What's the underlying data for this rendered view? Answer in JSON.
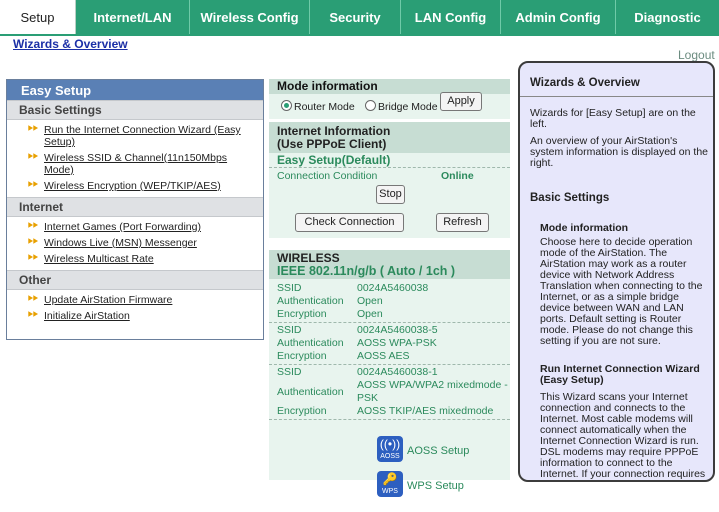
{
  "tabs": [
    {
      "label": "Setup",
      "active": true
    },
    {
      "label": "Internet/LAN",
      "active": false
    },
    {
      "label": "Wireless Config",
      "active": false
    },
    {
      "label": "Security",
      "active": false
    },
    {
      "label": "LAN Config",
      "active": false
    },
    {
      "label": "Admin Config",
      "active": false
    },
    {
      "label": "Diagnostic",
      "active": false
    }
  ],
  "breadcrumb": "Wizards & Overview",
  "logout": "Logout",
  "easy_setup": {
    "title": "Easy Setup",
    "sections": [
      {
        "title": "Basic Settings",
        "items": [
          "Run the Internet Connection Wizard (Easy Setup)",
          "Wireless SSID & Channel(11n150Mbps Mode)",
          "Wireless Encryption (WEP/TKIP/AES)"
        ]
      },
      {
        "title": "Internet",
        "items": [
          "Internet Games (Port Forwarding)",
          "Windows Live (MSN) Messenger",
          "Wireless Multicast Rate"
        ]
      },
      {
        "title": "Other",
        "items": [
          "Update AirStation Firmware",
          "Initialize AirStation"
        ]
      }
    ]
  },
  "mode": {
    "title": "Mode information",
    "router_label": "Router Mode",
    "bridge_label": "Bridge Mode",
    "selected": "router",
    "apply_label": "Apply"
  },
  "internet": {
    "title_line1": "Internet Information",
    "title_line2": "(Use PPPoE Client)",
    "subtitle": "Easy Setup(Default)",
    "condition_label": "Connection Condition",
    "condition_value": "Online",
    "stop_label": "Stop",
    "check_label": "Check Connection",
    "refresh_label": "Refresh"
  },
  "wireless": {
    "title": "WIRELESS",
    "standard": "IEEE 802.11n/g/b ( Auto / 1ch )",
    "entries": [
      {
        "ssid_label": "SSID",
        "ssid": "0024A5460038",
        "auth_label": "Authentication",
        "auth": "Open",
        "enc_label": "Encryption",
        "enc": "Open"
      },
      {
        "ssid_label": "SSID",
        "ssid": "0024A5460038-5",
        "auth_label": "Authentication",
        "auth": "AOSS WPA-PSK",
        "enc_label": "Encryption",
        "enc": "AOSS AES"
      },
      {
        "ssid_label": "SSID",
        "ssid": "0024A5460038-1",
        "auth_label": "Authentication",
        "auth": "AOSS WPA/WPA2 mixedmode - PSK",
        "enc_label": "Encryption",
        "enc": "AOSS TKIP/AES mixedmode"
      }
    ],
    "aoss_label": "AOSS Setup",
    "aoss_icon_text": "AOSS",
    "wps_label": "WPS Setup",
    "wps_icon_text": "WPS"
  },
  "help": {
    "title": "Wizards & Overview",
    "intro1": "Wizards for [Easy Setup] are on the left.",
    "intro2": "An overview of your AirStation's system information is displayed on the right.",
    "basic_title": "Basic Settings",
    "mode_title": "Mode information",
    "mode_text": "Choose here to decide operation mode of the AirStation. The AirStation may work as a router device with Network Address Translation when connecting to the Internet, or as a simple bridge device between WAN and LAN ports. Default setting is Router mode. Please do not change this setting if you are not sure.",
    "wizard_title": "Run Internet Connection Wizard (Easy Setup)",
    "wizard_text": "This Wizard scans your Internet connection and connects to the Internet. Most cable modems will connect automatically when the Internet Connection Wizard is run. DSL modems may require PPPoE information to connect to the Internet. If your connection requires a password or other PPPoE information, have it ready! Your ISP can provide this information if you don't have it."
  },
  "colors": {
    "tab_green": "#2a9e75",
    "easy_header_blue": "#5a80b5",
    "help_bg": "#e7e7fb"
  }
}
